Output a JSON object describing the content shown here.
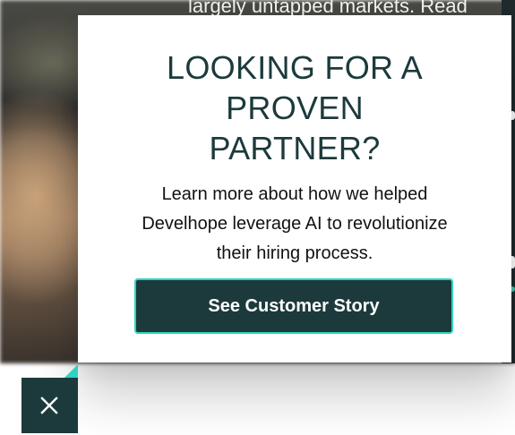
{
  "background": {
    "text": "largely untapped markets. Read"
  },
  "modal": {
    "title_lines": [
      "LOOKING FOR A",
      "PROVEN",
      "PARTNER?"
    ],
    "body_lines": [
      "Learn more about how we helped",
      "Develhope leverage AI to revolutionize",
      "their hiring process."
    ],
    "cta_label": "See Customer Story"
  },
  "close": {
    "icon": "close-icon"
  },
  "colors": {
    "brand_dark": "#1c3a3c",
    "accent_teal": "#2fd3bf",
    "body_text": "#111111",
    "modal_bg": "#ffffff"
  }
}
